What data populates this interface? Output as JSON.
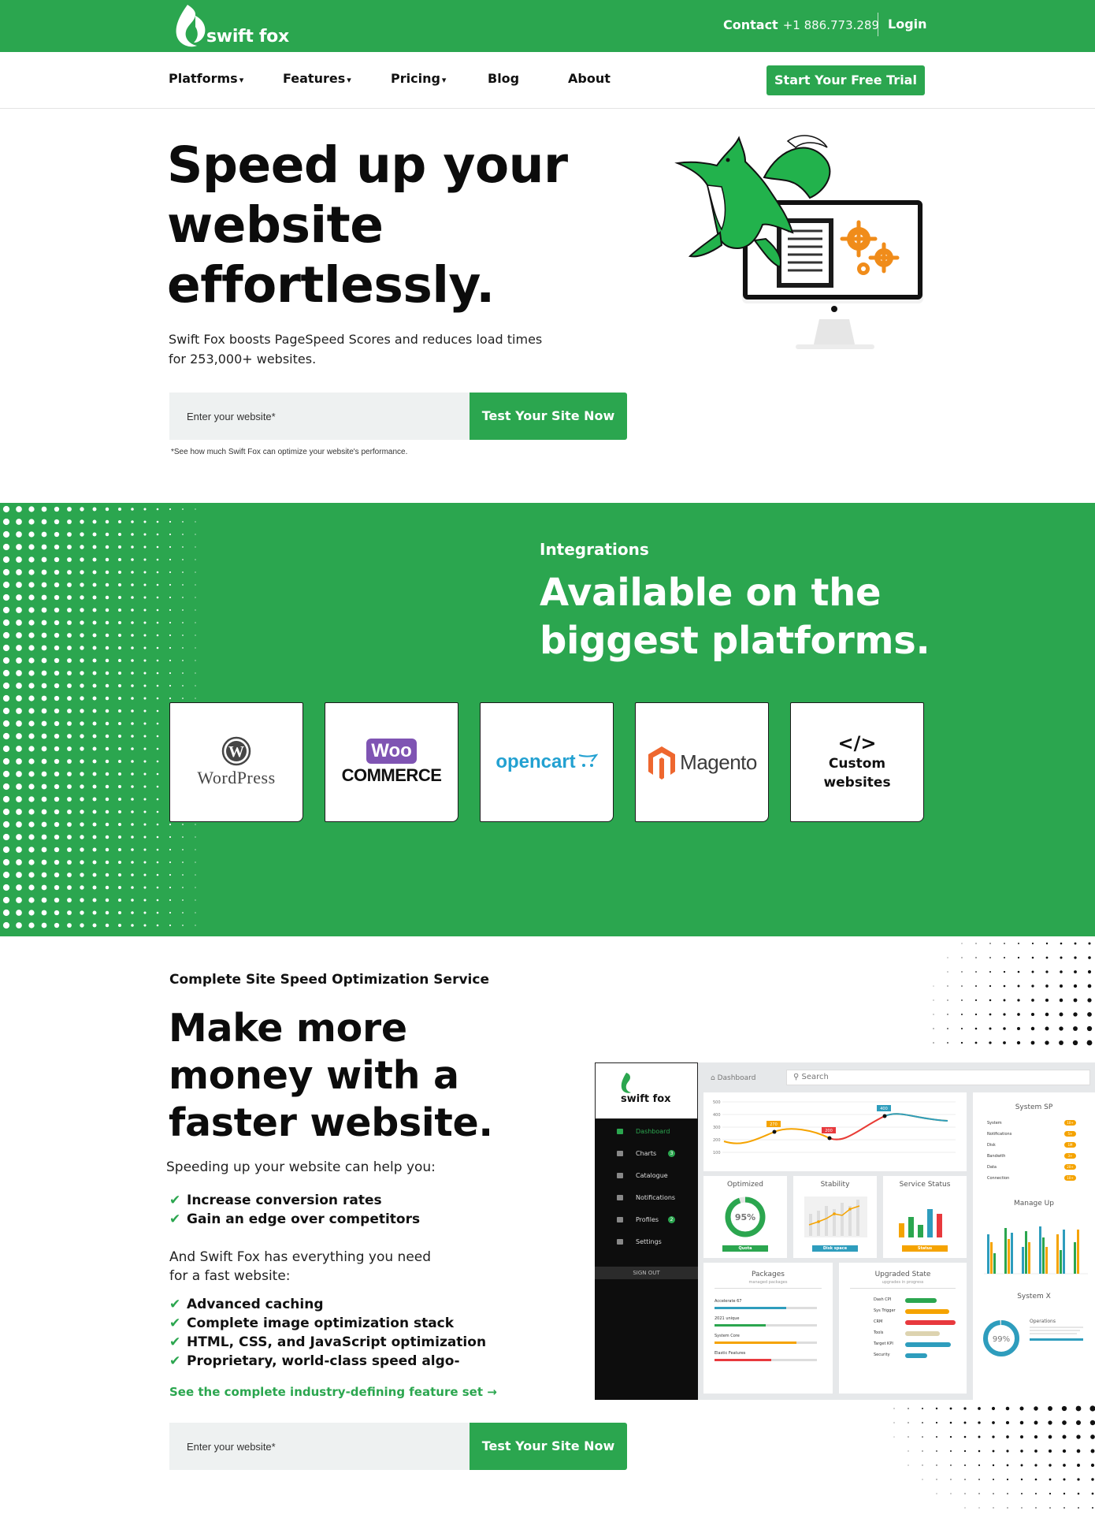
{
  "topbar": {
    "brand": "swift fox",
    "contact_label": "Contact",
    "phone": "+1 886.773.289",
    "login": "Login"
  },
  "nav": {
    "items": [
      {
        "label": "Platforms",
        "dropdown": true
      },
      {
        "label": "Features",
        "dropdown": true
      },
      {
        "label": "Pricing",
        "dropdown": true
      },
      {
        "label": "Blog",
        "dropdown": false
      },
      {
        "label": "About",
        "dropdown": false
      }
    ],
    "caret": "▾",
    "cta": "Start Your Free Trial"
  },
  "hero": {
    "title_line1": "Speed up your",
    "title_line2": "website",
    "title_line3": "effortlessly.",
    "subtitle_line1": "Swift Fox boosts PageSpeed Scores and reduces load times",
    "subtitle_line2": "for 253,000+ websites.",
    "form": {
      "placeholder": "Enter your website*",
      "button": "Test Your Site Now",
      "note": "*See how much Swift Fox can optimize your website's performance."
    }
  },
  "integrations": {
    "eyebrow": "Integrations",
    "title_line1": "Available on the",
    "title_line2": "biggest platforms.",
    "platforms": [
      {
        "name": "WordPress",
        "icon": "wordpress-logo"
      },
      {
        "name": "COMMERCE",
        "badge": "Woo",
        "icon": "woocommerce-logo"
      },
      {
        "name": "opencart",
        "icon": "opencart-logo"
      },
      {
        "name": "Magento",
        "icon": "magento-logo"
      },
      {
        "name_line1": "Custom",
        "name_line2": "websites",
        "icon": "code-icon"
      }
    ]
  },
  "optimization": {
    "eyebrow": "Complete Site Speed Optimization Service",
    "title_line1": "Make more",
    "title_line2": "money with a",
    "title_line3": "faster website.",
    "intro": "Speeding up your website can help you:",
    "benefits": [
      "Increase conversion rates",
      "Gain an edge over competitors"
    ],
    "mid_line1": "And Swift Fox has everything you need",
    "mid_line2": "for a fast website:",
    "features": [
      "Advanced caching",
      "Complete image optimization stack",
      "HTML, CSS, and JavaScript optimization",
      "Proprietary, world-class speed algo-"
    ],
    "link": "See the complete industry-defining feature set",
    "link_arrow": "→",
    "form": {
      "placeholder": "Enter your website*",
      "button": "Test Your Site Now"
    }
  },
  "dashboard": {
    "brand": "swift fox",
    "menu": [
      {
        "label": "Dashboard",
        "active": true
      },
      {
        "label": "Charts",
        "badge": "3"
      },
      {
        "label": "Catalogue"
      },
      {
        "label": "Notifications"
      },
      {
        "label": "Profiles",
        "badge": "2"
      },
      {
        "label": "Settings"
      }
    ],
    "signout": "SIGN OUT",
    "crumb": "Dashboard",
    "search": "Search",
    "line_chart": {
      "y_ticks": [
        "500",
        "400",
        "300",
        "200",
        "100"
      ],
      "callouts": [
        "270",
        "200",
        "400"
      ]
    },
    "optimized": {
      "title": "Optimized",
      "value": "95%",
      "tag": "Quota"
    },
    "stability": {
      "title": "Stability",
      "tag": "Disk space"
    },
    "service": {
      "title": "Service Status",
      "tag": "Status"
    },
    "system_sp": {
      "title": "System SP",
      "rows": [
        "System",
        "Notifications",
        "Disk",
        "Bandwith",
        "Data",
        "Connection"
      ],
      "pills": [
        "10+",
        "5+",
        "1M",
        "3+",
        "20+",
        "10+"
      ]
    },
    "manage": {
      "title": "Manage Up"
    },
    "system_x": {
      "title": "System X",
      "value": "99%",
      "label": "Operations"
    },
    "packages": {
      "title": "Packages",
      "subtitle": "managed packages",
      "rows": [
        "Accelerate 67",
        "2021 unique",
        "System Core",
        "Elastic Features"
      ]
    },
    "upgraded": {
      "title": "Upgraded State",
      "subtitle": "upgrades in progress",
      "rows": [
        "Dash CPI",
        "Sys Trigger",
        "CRM",
        "Tools",
        "Target KPI",
        "Security"
      ]
    },
    "colors": {
      "green": "#2ba64f",
      "orange": "#f5a300",
      "red": "#e8393d",
      "teal": "#2e9dbd"
    }
  },
  "colors": {
    "brand_green": "#2ba64f"
  }
}
